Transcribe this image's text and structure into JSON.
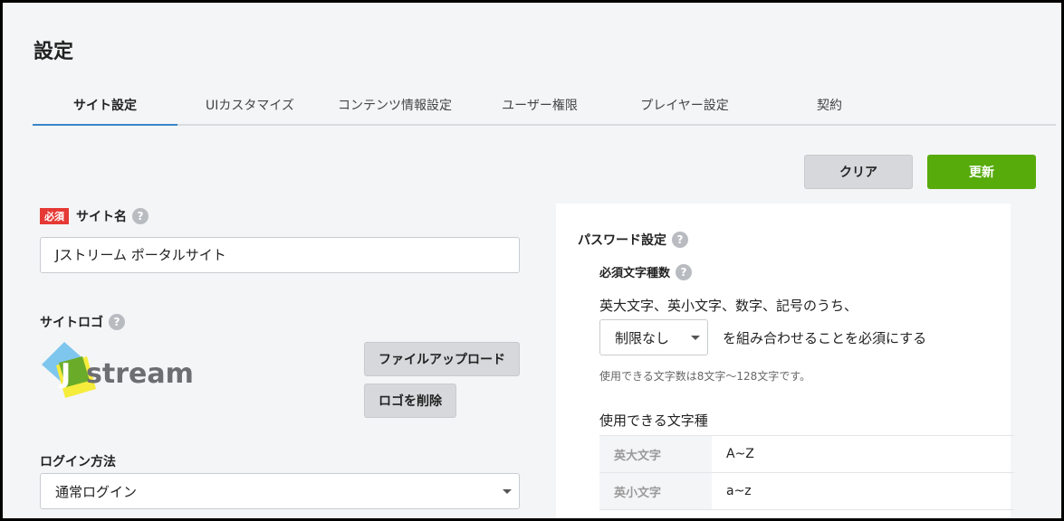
{
  "page": {
    "title": "設定"
  },
  "tabs": [
    {
      "label": "サイト設定",
      "active": true
    },
    {
      "label": "UIカスタマイズ"
    },
    {
      "label": "コンテンツ情報設定"
    },
    {
      "label": "ユーザー権限"
    },
    {
      "label": "プレイヤー設定"
    },
    {
      "label": "契約"
    }
  ],
  "actions": {
    "clear": "クリア",
    "update": "更新"
  },
  "site_name": {
    "required_badge": "必須",
    "label": "サイト名",
    "value": "Jストリーム ポータルサイト"
  },
  "site_logo": {
    "label": "サイトロゴ",
    "logo_text": "stream",
    "logo_letter": "J",
    "upload_button": "ファイルアップロード",
    "delete_button": "ロゴを削除"
  },
  "login": {
    "label": "ログイン方法",
    "selected": "通常ログイン"
  },
  "password": {
    "title": "パスワード設定",
    "required_types_label": "必須文字種数",
    "description": "英大文字、英小文字、数字、記号のうち、",
    "select_value": "制限なし",
    "suffix": "を組み合わせることを必須にする",
    "note": "使用できる文字数は8文字〜128文字です。",
    "charset_title": "使用できる文字種",
    "charset_rows": [
      {
        "key": "英大文字",
        "value": "A~Z"
      },
      {
        "key": "英小文字",
        "value": "a~z"
      }
    ]
  },
  "help_glyph": "?",
  "colors": {
    "accent": "#3a86c8",
    "primary": "#57ab0a",
    "required": "#e53935"
  }
}
